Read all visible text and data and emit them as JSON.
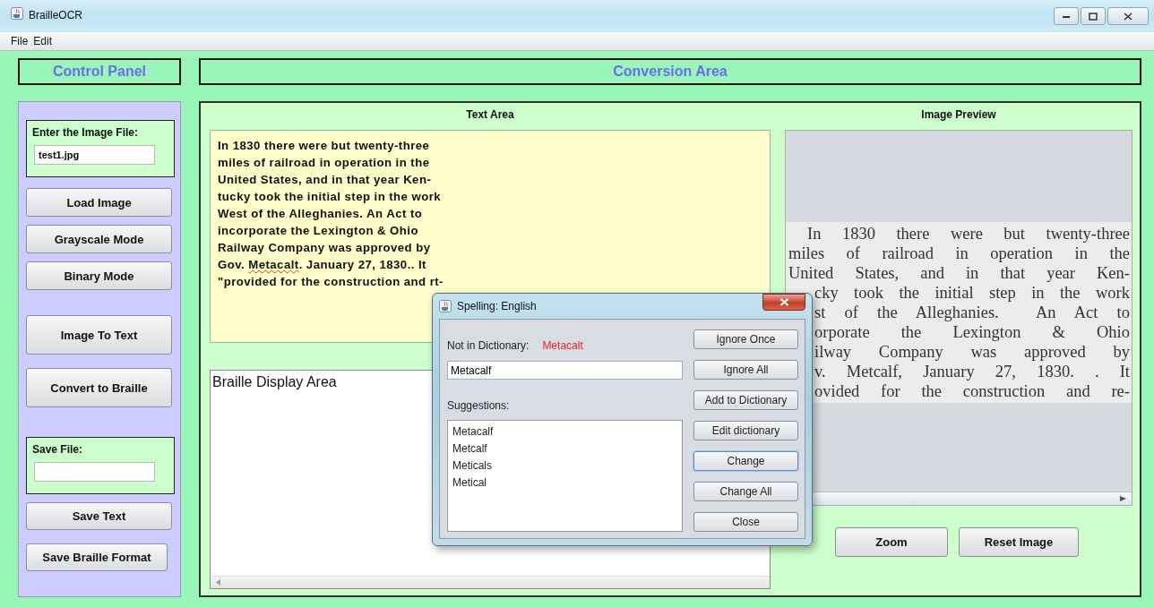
{
  "window": {
    "title": "BrailleOCR"
  },
  "menu": [
    {
      "label": "File"
    },
    {
      "label": "Edit"
    }
  ],
  "control_panel": {
    "title": "Control Panel",
    "image_file": {
      "label": "Enter the Image File:",
      "value": "test1.jpg"
    },
    "mode_buttons": [
      "Load Image",
      "Grayscale Mode",
      "Binary Mode"
    ],
    "action_buttons": [
      "Image To Text",
      "Convert to Braille"
    ],
    "save_file": {
      "label": "Save File:"
    },
    "save_buttons": [
      "Save Text",
      "Save Braille Format"
    ]
  },
  "conversion_area": {
    "title": "Conversion Area",
    "text_area": {
      "title": "Text Area",
      "lines": [
        [
          {
            "text": "In 1830 there were but twenty-three",
            "misspelled": false
          }
        ],
        [
          {
            "text": "miles of railroad in operation in the",
            "misspelled": false
          }
        ],
        [
          {
            "text": "United States, and in that year Ken-",
            "misspelled": false
          }
        ],
        [
          {
            "text": "tucky took the initial step in the work",
            "misspelled": false
          }
        ],
        [
          {
            "text": "West of the Alleghanies. An Act to",
            "misspelled": false
          }
        ],
        [
          {
            "text": "incorporate the Lexington & Ohio",
            "misspelled": false
          }
        ],
        [
          {
            "text": "Railway Company was approved by",
            "misspelled": false
          }
        ],
        [
          {
            "text": "Gov. ",
            "misspelled": false
          },
          {
            "text": "Metacalt",
            "misspelled": true
          },
          {
            "text": ". January 27, 1830.. It",
            "misspelled": false
          }
        ],
        [
          {
            "text": "\"provided for the construction and rt-",
            "misspelled": false
          }
        ]
      ]
    },
    "braille_area": {
      "text": "Braille Display Area"
    },
    "image_preview": {
      "title": "Image Preview",
      "lines": [
        {
          "text": "In 1830 there were but twenty-three",
          "cut": false,
          "indent": true
        },
        {
          "text": "miles of railroad in operation in the",
          "cut": false,
          "indent": false
        },
        {
          "text": "United States, and in that year Ken-",
          "cut": false,
          "indent": false
        },
        {
          "text": "cky took the initial step in the work",
          "cut": true,
          "indent": false
        },
        {
          "text": "st of the Alleghanies.  An Act to",
          "cut": true,
          "indent": false
        },
        {
          "text": "orporate the Lexington & Ohio",
          "cut": true,
          "indent": false
        },
        {
          "text": "ilway Company was approved by",
          "cut": true,
          "indent": false
        },
        {
          "text": "v. Metcalf, January 27, 1830. . It",
          "cut": true,
          "indent": false
        },
        {
          "text": "ovided for the construction and re-",
          "cut": true,
          "indent": false
        }
      ]
    },
    "preview_buttons": [
      "Zoom",
      "Reset Image"
    ]
  },
  "dialog": {
    "title": "Spelling: English",
    "not_in_dictionary": {
      "label": "Not in Dictionary:",
      "word": "Metacalt"
    },
    "replacement": {
      "value": "Metacalf"
    },
    "suggestions": {
      "label": "Suggestions:",
      "items": [
        {
          "text": "Metacalf",
          "selected": false
        },
        {
          "text": "Metcalf",
          "selected": false
        },
        {
          "text": "Meticals",
          "selected": false
        },
        {
          "text": "Metical",
          "selected": false
        }
      ]
    },
    "buttons": [
      {
        "label": "Ignore Once",
        "focused": false
      },
      {
        "label": "Ignore All",
        "focused": false
      },
      {
        "label": "Add to Dictionary",
        "focused": false
      },
      {
        "label": "Edit dictionary",
        "focused": false
      },
      {
        "label": "Change",
        "focused": true
      },
      {
        "label": "Change All",
        "focused": false
      },
      {
        "label": "Close",
        "focused": false
      }
    ]
  }
}
